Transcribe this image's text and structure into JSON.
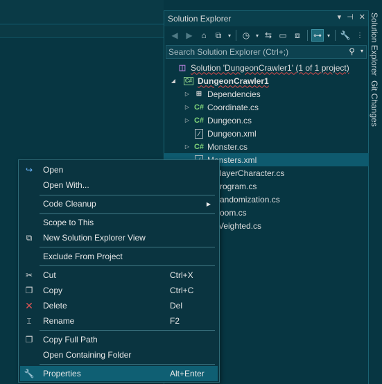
{
  "solution_explorer": {
    "title": "Solution Explorer",
    "title_buttons": [
      "▾",
      "⊣",
      "✕"
    ],
    "search_placeholder": "Search Solution Explorer (Ctrl+;)",
    "tree": [
      {
        "label": "Solution 'DungeonCrawler1' (1 of 1 project)",
        "icon": "solution-icon"
      },
      {
        "label": "DungeonCrawler1",
        "icon": "csharp-project-icon"
      },
      {
        "label": "Dependencies",
        "icon": "dependencies-icon"
      },
      {
        "label": "Coordinate.cs",
        "icon": "csharp-file-icon"
      },
      {
        "label": "Dungeon.cs",
        "icon": "csharp-file-icon"
      },
      {
        "label": "Dungeon.xml",
        "icon": "xml-file-icon"
      },
      {
        "label": "Monster.cs",
        "icon": "csharp-file-icon"
      },
      {
        "label": "Monsters.xml",
        "icon": "xml-file-icon"
      },
      {
        "label": "layerCharacter.cs"
      },
      {
        "label": "rogram.cs"
      },
      {
        "label": "andomization.cs"
      },
      {
        "label": "oom.cs"
      },
      {
        "label": "Veighted.cs"
      }
    ]
  },
  "side_tabs": {
    "solution_explorer": "Solution Explorer",
    "git_changes": "Git Changes"
  },
  "context_menu": {
    "open": "Open",
    "open_with": "Open With...",
    "code_cleanup": "Code Cleanup",
    "scope_to_this": "Scope to This",
    "new_se_view": "New Solution Explorer View",
    "exclude": "Exclude From Project",
    "cut": "Cut",
    "cut_shortcut": "Ctrl+X",
    "copy": "Copy",
    "copy_shortcut": "Ctrl+C",
    "delete": "Delete",
    "delete_shortcut": "Del",
    "rename": "Rename",
    "rename_shortcut": "F2",
    "copy_full_path": "Copy Full Path",
    "open_containing_folder": "Open Containing Folder",
    "properties": "Properties",
    "properties_shortcut": "Alt+Enter"
  },
  "colors": {
    "background": "#073642",
    "selection": "#0e5a6e",
    "accent_csharp": "#7fd37a",
    "error_squiggle": "#e04848"
  }
}
